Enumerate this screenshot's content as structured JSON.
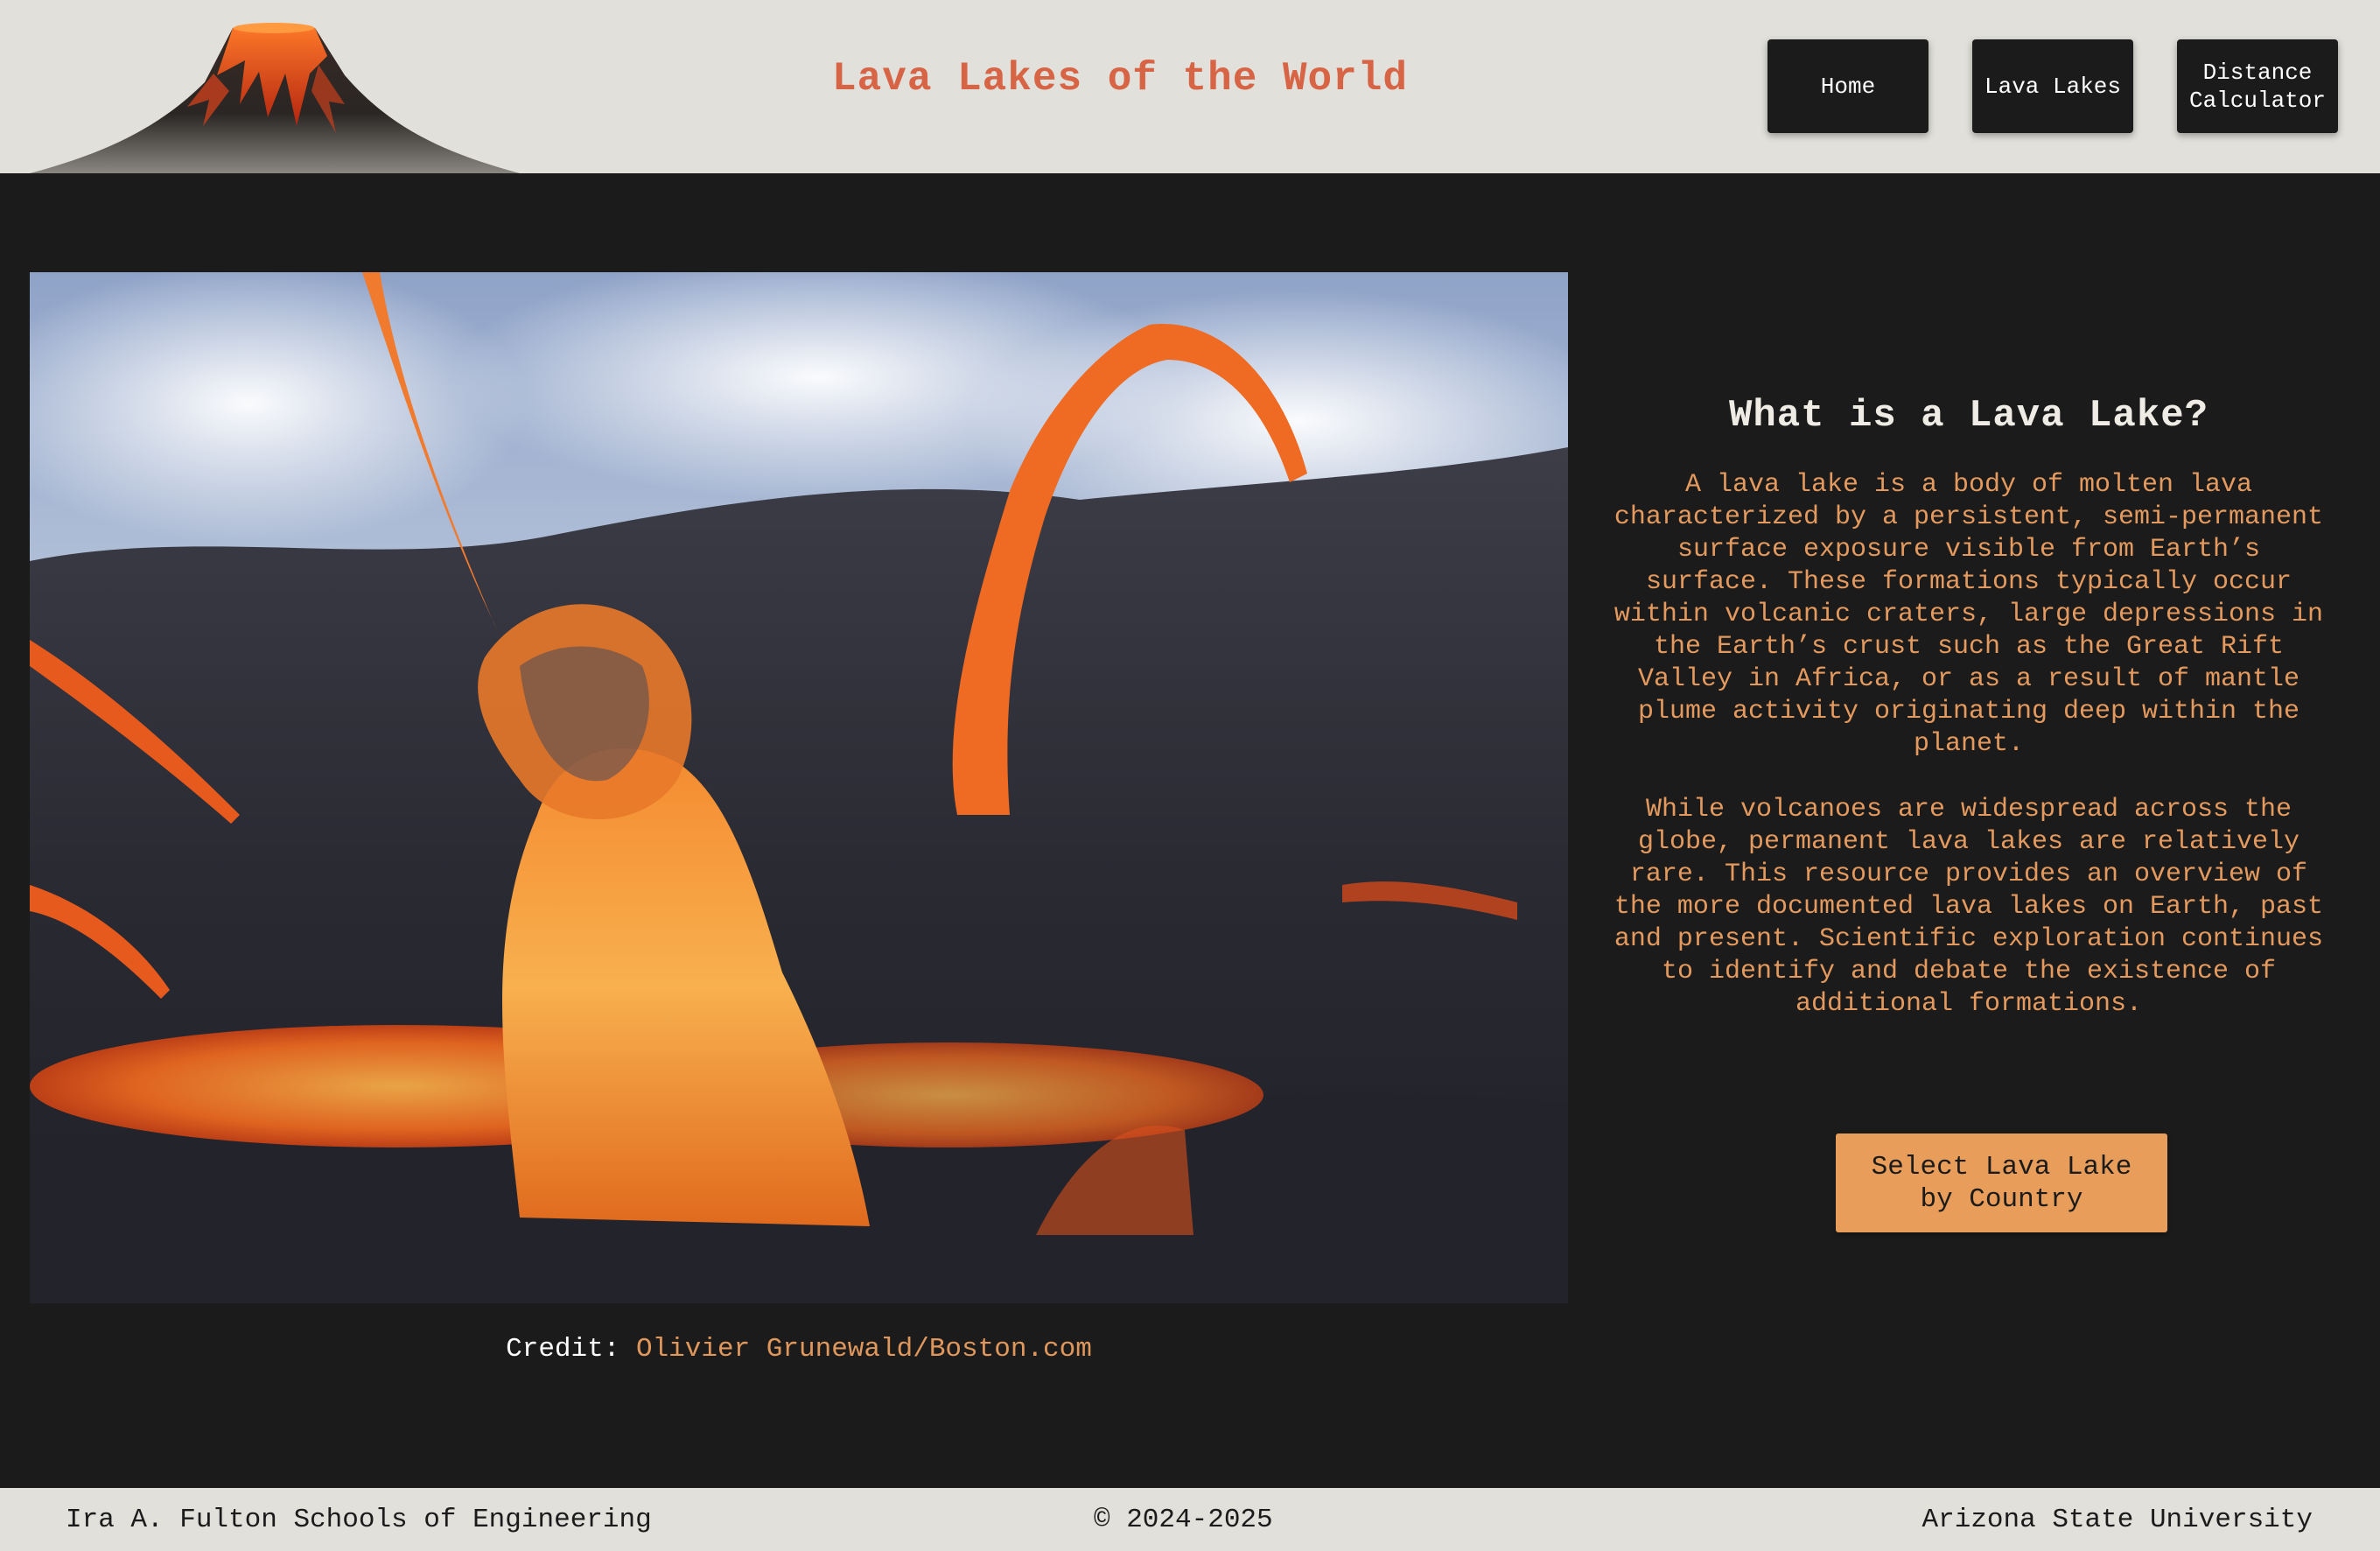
{
  "header": {
    "title": "Lava Lakes of the World",
    "nav": {
      "home": "Home",
      "lava_lakes": "Lava Lakes",
      "distance_calculator": "Distance Calculator"
    }
  },
  "main": {
    "photo_credit_label": "Credit:",
    "photo_credit_link": "Olivier Grunewald/Boston.com",
    "heading": "What is a Lava Lake?",
    "paragraph_1": "A lava lake is a body of molten lava characterized by a persistent, semi-permanent surface exposure visible from Earth’s surface. These formations typically occur within volcanic craters, large depressions in the Earth’s crust such as the Great Rift Valley in Africa, or as a result of mantle plume activity originating deep within the planet.",
    "paragraph_2": "While volcanoes are widespread across the globe, permanent lava lakes are relatively rare. This resource provides an overview of the more documented lava lakes on Earth, past and present. Scientific exploration continues to identify and debate the existence of additional formations.",
    "cta_label": "Select Lava Lake by Country"
  },
  "footer": {
    "left": "Ira A. Fulton Schools of Engineering",
    "center": "© 2024-2025",
    "right": "Arizona State University"
  },
  "colors": {
    "header_bg": "#e1e0da",
    "page_bg": "#1b1b1b",
    "title": "#d86446",
    "body_text": "#e49a5e",
    "cta_bg": "#e89e5a"
  },
  "icons": {
    "logo": "volcano-logo",
    "hero": "lava-fountain-photo"
  }
}
